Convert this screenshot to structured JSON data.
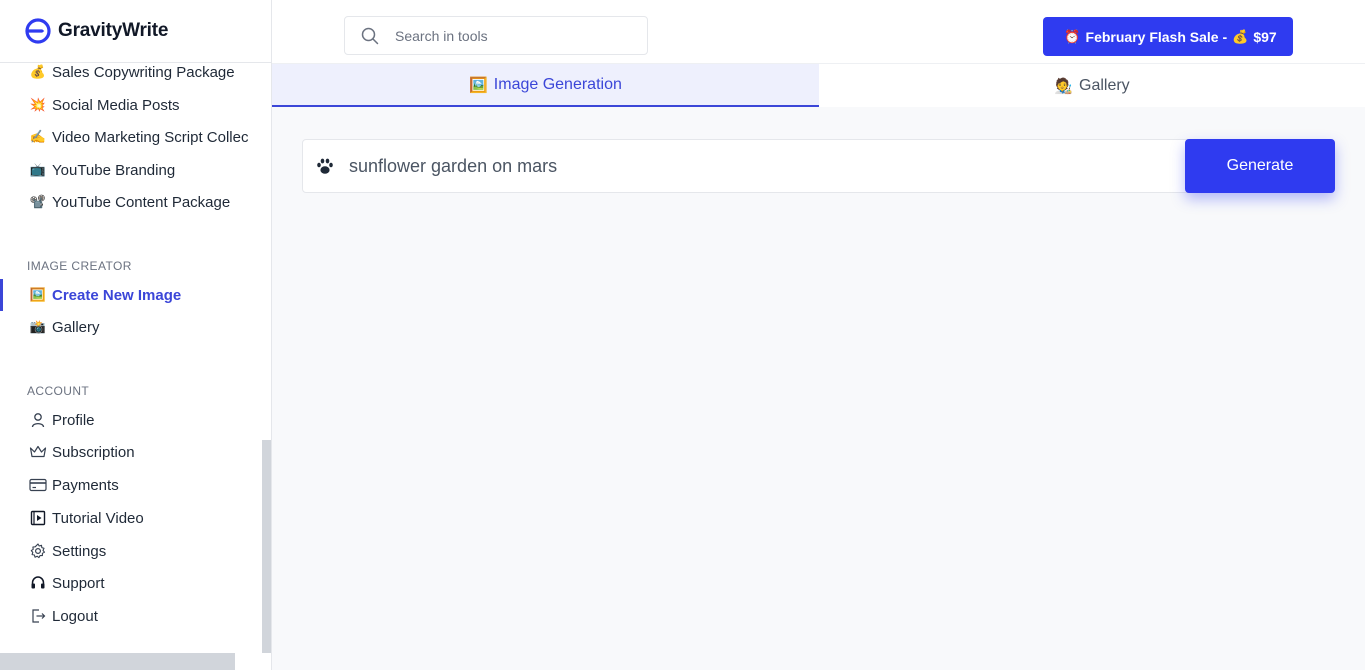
{
  "brand": {
    "name": "GravityWrite"
  },
  "sidebar": {
    "tool_items": [
      {
        "emoji": "💰",
        "label": "Sales Copywriting Package"
      },
      {
        "emoji": "💥",
        "label": "Social Media Posts"
      },
      {
        "emoji": "✍️",
        "label": "Video Marketing Script Collec"
      },
      {
        "emoji": "📺",
        "label": "YouTube Branding"
      },
      {
        "emoji": "📽️",
        "label": "YouTube Content Package"
      }
    ],
    "image_section": "IMAGE CREATOR",
    "image_items": [
      {
        "emoji": "🖼️",
        "label": "Create New Image",
        "active": true
      },
      {
        "emoji": "📸",
        "label": "Gallery",
        "active": false
      }
    ],
    "account_section": "ACCOUNT",
    "account_items": [
      {
        "icon": "user-icon",
        "label": "Profile"
      },
      {
        "icon": "crown-icon",
        "label": "Subscription"
      },
      {
        "icon": "credit-card-icon",
        "label": "Payments"
      },
      {
        "icon": "video-play-icon",
        "label": "Tutorial Video"
      },
      {
        "icon": "gear-icon",
        "label": "Settings"
      },
      {
        "icon": "headset-icon",
        "label": "Support"
      },
      {
        "icon": "logout-icon",
        "label": "Logout"
      }
    ]
  },
  "header": {
    "search_placeholder": "Search in tools",
    "sale": {
      "emoji_left": "⏰",
      "label": "February Flash Sale -",
      "emoji_right": "💰",
      "price": "$97"
    }
  },
  "tabs": [
    {
      "emoji": "🖼️",
      "label": "Image Generation",
      "active": true
    },
    {
      "emoji": "🧑‍🎨",
      "label": "Gallery",
      "active": false
    }
  ],
  "prompt": {
    "value": "sunflower garden on mars",
    "icon": "paw-icon"
  },
  "generate_label": "Generate",
  "colors": {
    "accent": "#2f3bf0",
    "active_text": "#3b46d8",
    "tab_active_bg": "#eef0fd"
  }
}
